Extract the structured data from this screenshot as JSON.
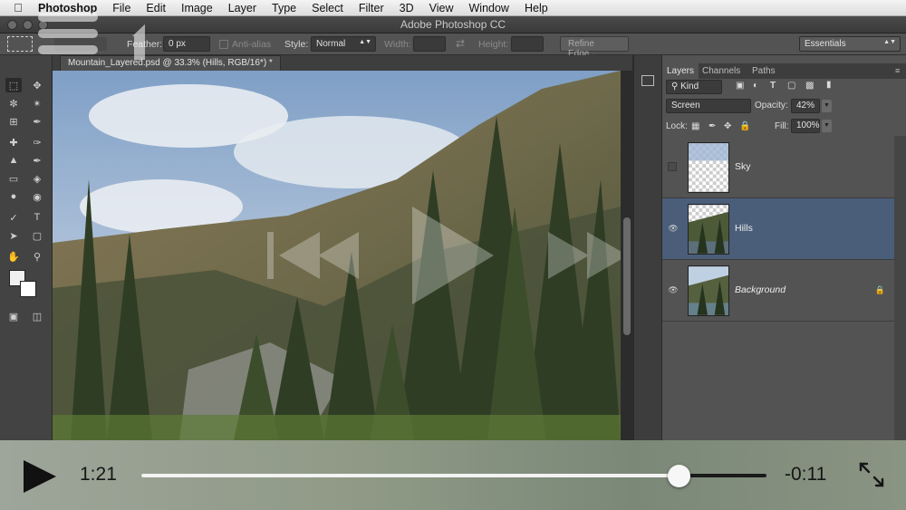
{
  "menubar": {
    "app_name": "Photoshop",
    "items": [
      "File",
      "Edit",
      "Image",
      "Layer",
      "Type",
      "Select",
      "Filter",
      "3D",
      "View",
      "Window",
      "Help"
    ]
  },
  "window": {
    "title": "Adobe Photoshop CC"
  },
  "options": {
    "feather_label": "Feather:",
    "feather_value": "0 px",
    "antialias_label": "Anti-alias",
    "style_label": "Style:",
    "style_value": "Normal",
    "width_label": "Width:",
    "height_label": "Height:",
    "refine_edge_label": "Refine Edge...",
    "workspace_value": "Essentials"
  },
  "document": {
    "tab_title": "Mountain_Layered.psd @ 33.3% (Hills, RGB/16*) *"
  },
  "layers_panel": {
    "tabs": [
      "Layers",
      "Channels",
      "Paths"
    ],
    "active_tab": "Layers",
    "filter_value": "Kind",
    "blend_mode": "Screen",
    "opacity_label": "Opacity:",
    "opacity_value": "42%",
    "lock_label": "Lock:",
    "fill_label": "Fill:",
    "fill_value": "100%",
    "layers": [
      {
        "name": "Sky",
        "visible": false,
        "selected": false,
        "locked": false
      },
      {
        "name": "Hills",
        "visible": true,
        "selected": true,
        "locked": false
      },
      {
        "name": "Background",
        "visible": true,
        "selected": false,
        "locked": true
      }
    ]
  },
  "player": {
    "elapsed": "1:21",
    "remaining": "-0:11",
    "progress": 0.86,
    "state": "paused"
  },
  "colors": {
    "accent_selected_layer": "#4a5e79",
    "panel_bg": "#535353",
    "player_bar": "#8f9a86"
  },
  "icons": [
    "apple-icon",
    "marquee-tool-icon",
    "move-tool-icon",
    "home-icon",
    "menu-icon",
    "rewind-icon",
    "play-icon",
    "fast-forward-icon",
    "eye-icon",
    "lock-icon",
    "fullscreen-icon"
  ]
}
